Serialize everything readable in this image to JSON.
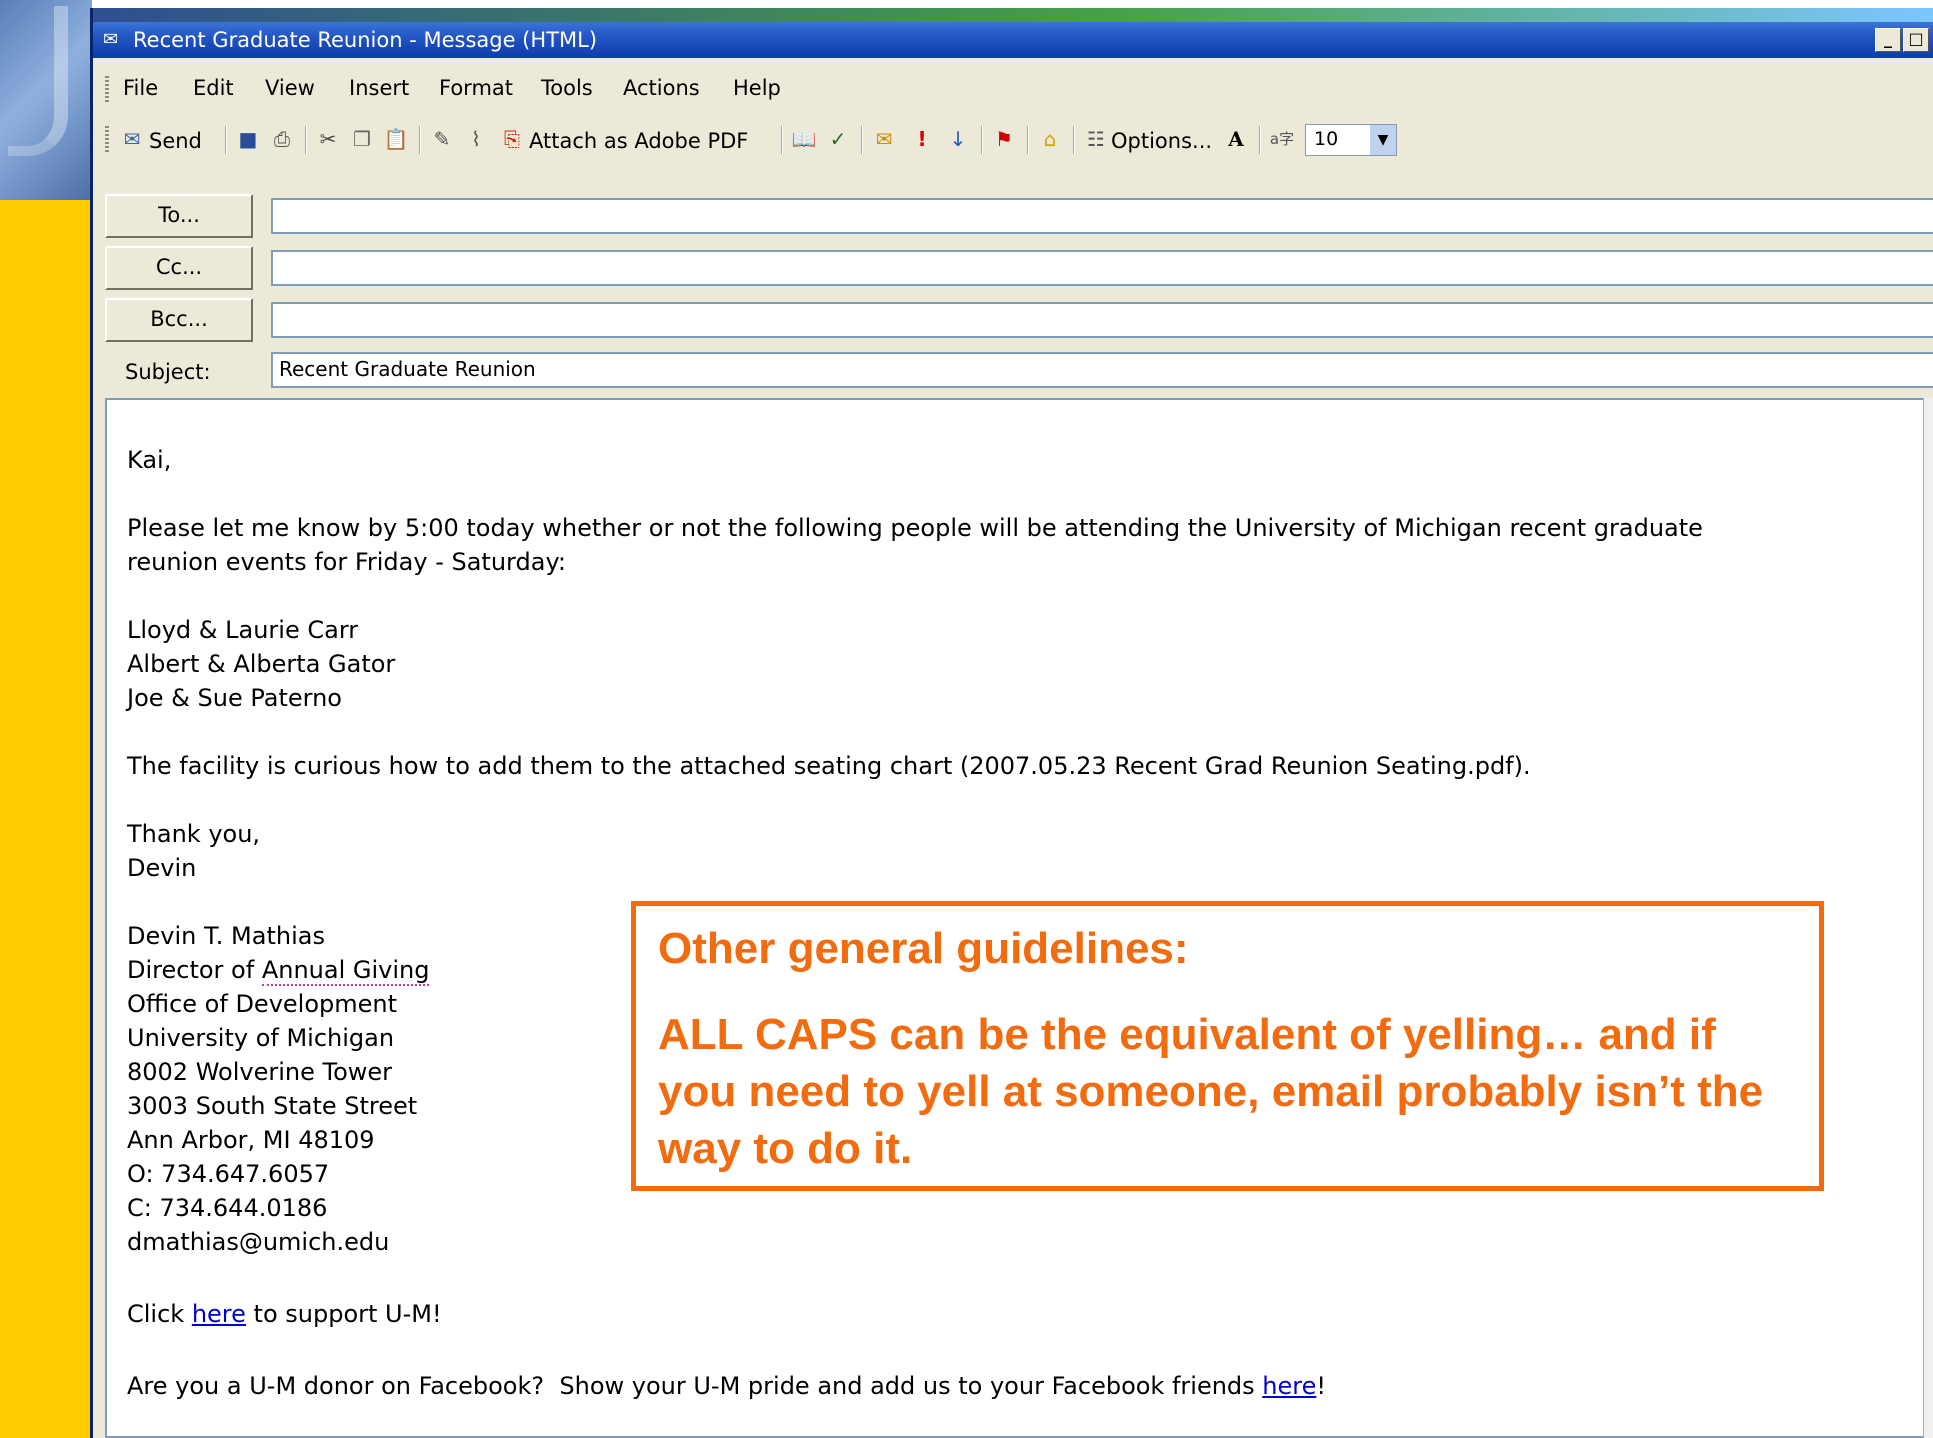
{
  "window": {
    "title": "Recent Graduate Reunion - Message (HTML)"
  },
  "menu": [
    "File",
    "Edit",
    "View",
    "Insert",
    "Format",
    "Tools",
    "Actions",
    "Help"
  ],
  "toolbar": {
    "send_label": "Send",
    "attach_pdf_label": "Attach as Adobe PDF",
    "options_label": "Options...",
    "font_size_value": "10"
  },
  "header": {
    "to_label": "To...",
    "cc_label": "Cc...",
    "bcc_label": "Bcc...",
    "subject_label": "Subject:",
    "subject_value": "Recent Graduate Reunion"
  },
  "body": {
    "greeting": "Kai,",
    "para1_line1": "Please let me know by 5:00 today whether or not the following people will be attending the University of Michigan recent graduate",
    "para1_line2": "reunion events for Friday - Saturday:",
    "names": [
      "Lloyd & Laurie Carr",
      "Albert & Alberta Gator",
      "Joe & Sue Paterno"
    ],
    "para2": "The facility is curious how to add them to the attached seating chart (2007.05.23 Recent Grad Reunion Seating.pdf).",
    "closing": "Thank you,",
    "closing_name": "Devin",
    "signature": {
      "name": "Devin T. Mathias",
      "title_prefix": "Director of ",
      "title_link": "Annual Giving",
      "office": "Office of Development",
      "university": "University of Michigan",
      "address1": "8002 Wolverine Tower",
      "address2": "3003 South State Street",
      "city": "Ann Arbor, MI 48109",
      "office_phone": "O: 734.647.6057",
      "cell_phone": "C: 734.644.0186",
      "email": "dmathias@umich.edu"
    },
    "support_prefix": "Click ",
    "support_link": "here",
    "support_suffix": " to support U-M!",
    "facebook_text": "Are you a U-M donor on Facebook?  Show your U-M pride and add us to your Facebook friends ",
    "facebook_link": "here",
    "facebook_suffix": "!"
  },
  "callout": {
    "heading": "Other general guidelines:",
    "body": "ALL CAPS can be the equivalent of yelling… and if you need to yell at someone, email probably isn’t the way to do it."
  },
  "colors": {
    "accent_orange": "#f26b0f",
    "titlebar_blue": "#0e3bab",
    "slide_yellow": "#ffcc00"
  }
}
